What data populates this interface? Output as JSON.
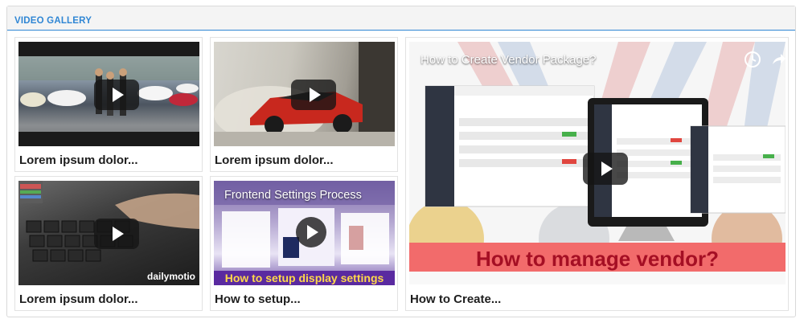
{
  "gallery": {
    "title": "VIDEO GALLERY",
    "videos": [
      {
        "caption": "Lorem ipsum dolor..."
      },
      {
        "caption": "Lorem ipsum dolor..."
      },
      {
        "caption": "Lorem ipsum dolor...",
        "overlay_brand": "dailymotio"
      },
      {
        "caption": "How to setup...",
        "overlay_title": "Frontend Settings Process",
        "overlay_banner": "How to setup display settings"
      },
      {
        "caption": "How to Create...",
        "overlay_title": "How to Create Vendor Package?",
        "overlay_banner": "How to manage vendor?"
      }
    ]
  },
  "colors": {
    "accent": "#2f86d4",
    "banner_red": "#f26b6b",
    "banner_text": "#a50f24"
  },
  "icons": [
    "play-icon",
    "clock-icon",
    "share-icon"
  ]
}
